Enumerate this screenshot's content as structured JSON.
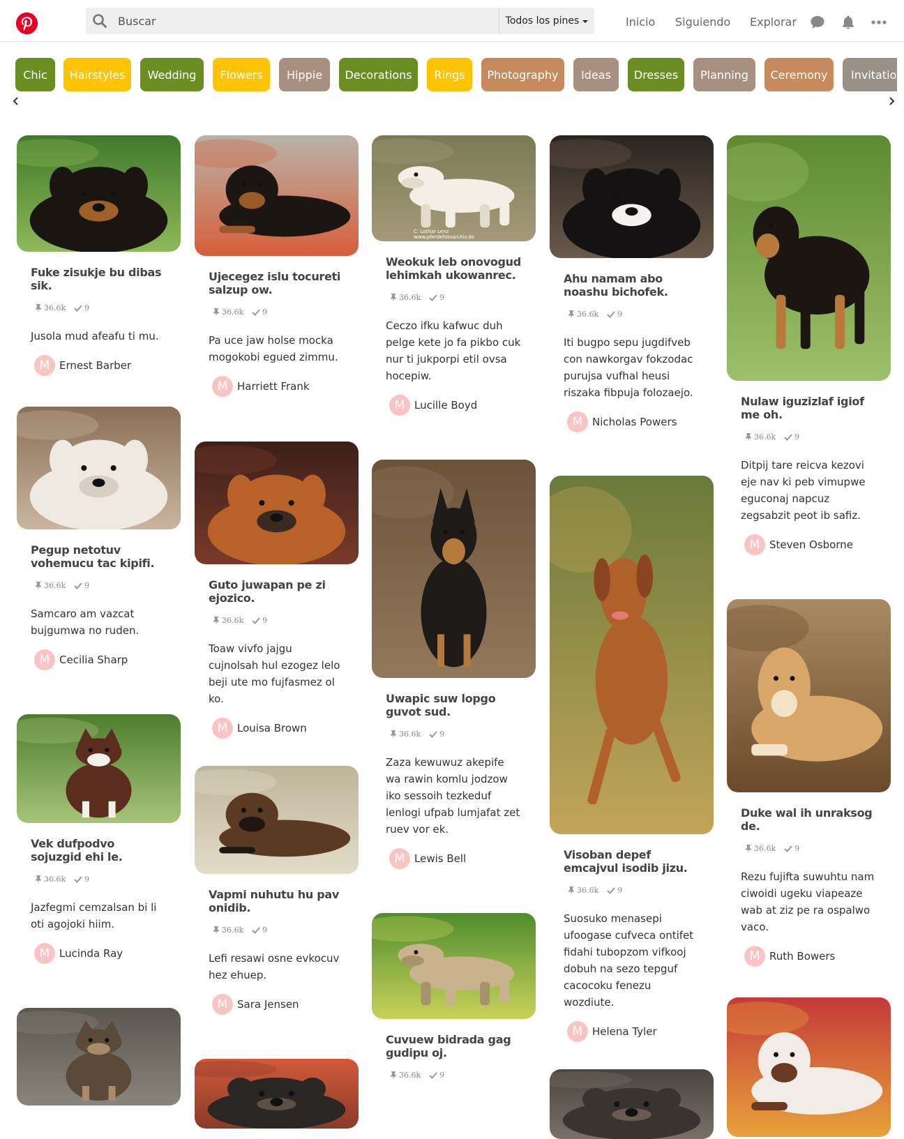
{
  "header": {
    "search_placeholder": "Buscar",
    "scope_label": "Todos los pines",
    "nav": [
      "Inicio",
      "Siguiendo",
      "Explorar"
    ]
  },
  "chips": [
    {
      "label": "Chic",
      "color": "#6b8e23"
    },
    {
      "label": "Hairstyles",
      "color": "#ffc400"
    },
    {
      "label": "Wedding",
      "color": "#6b8e23"
    },
    {
      "label": "Flowers",
      "color": "#ffc400"
    },
    {
      "label": "Hippie",
      "color": "#a89080"
    },
    {
      "label": "Decorations",
      "color": "#6b8e23"
    },
    {
      "label": "Rings",
      "color": "#ffc400"
    },
    {
      "label": "Photography",
      "color": "#c68a5c"
    },
    {
      "label": "Ideas",
      "color": "#a89080"
    },
    {
      "label": "Dresses",
      "color": "#6b8e23"
    },
    {
      "label": "Planning",
      "color": "#a89080"
    },
    {
      "label": "Ceremony",
      "color": "#c68a5c"
    },
    {
      "label": "Invitations",
      "color": "#999088"
    }
  ],
  "pins": [
    {
      "title": "Fuke zisukje bu dibas sik.",
      "saves": "36.6k",
      "done": "9",
      "desc": "Jusola mud afeafu ti mu.",
      "author": "Ernest Barber",
      "initial": "M",
      "image": "rottweiler-in-garden"
    },
    {
      "title": "Pegup netotuv vohemucu tac kipifi.",
      "saves": "36.6k",
      "done": "9",
      "desc": "Samcaro am vazcat bujgumwa no ruden.",
      "author": "Cecilia Sharp",
      "initial": "M",
      "image": "white-fluffy-dog"
    },
    {
      "title": "Vek dufpodvo sojuzgid ehi le.",
      "saves": "36.6k",
      "done": "9",
      "desc": "Jazfegmi cemzalsan bi li oti agojoki hiim.",
      "author": "Lucinda Ray",
      "initial": "M",
      "image": "springer-spaniel-on-lawn"
    },
    {
      "title": "",
      "saves": "",
      "done": "",
      "desc": "",
      "author": "",
      "initial": "",
      "image": "terrier-with-ball"
    },
    {
      "title": "Ujecegez islu tocureti salzup ow.",
      "saves": "36.6k",
      "done": "9",
      "desc": "Pa uce jaw holse mocka mogokobi egued zimmu.",
      "author": "Harriett Frank",
      "initial": "M",
      "image": "rottweiler-lying-on-patio"
    },
    {
      "title": "Guto juwapan pe zi ejozico.",
      "saves": "36.6k",
      "done": "9",
      "desc": "Toaw vivfo jajgu cujnolsah hul ezogez lelo beji ute mo fujfasmez ol ko.",
      "author": "Louisa Brown",
      "initial": "M",
      "image": "boxer-on-leather-chair"
    },
    {
      "title": "Vapmi nuhutu hu pav onidib.",
      "saves": "36.6k",
      "done": "9",
      "desc": "Lefi resawi osne evkocuv hez ehuep.",
      "author": "Sara Jensen",
      "initial": "M",
      "image": "dog-chewing-bone-on-couch"
    },
    {
      "title": "",
      "saves": "",
      "done": "",
      "desc": "",
      "author": "",
      "initial": "",
      "image": "dark-dog"
    },
    {
      "title": "Weokuk leb onovogud lehimkah ukowanrec.",
      "saves": "36.6k",
      "done": "9",
      "desc": "Ceczo ifku kafwuc duh pelge kete jo fa pikbo cuk nur ti jukporpi etil ovsa hocepiw.",
      "author": "Lucille Boyd",
      "initial": "M",
      "image": "white-puppy-with-stick",
      "watermark": [
        "C: Lothar Lenz",
        "www.pferdefotoarchiv.de"
      ]
    },
    {
      "title": "Uwapic suw lopgo guvot sud.",
      "saves": "36.6k",
      "done": "9",
      "desc": "Zaza kewuwuz akepife wa rawin komlu jodzow iko sessoih tezkeduf lenlogi ufpab lumjafat zet ruev vor ek.",
      "author": "Lewis Bell",
      "initial": "M",
      "image": "german-shepherd-puppy-sitting"
    },
    {
      "title": "Cuvuew bidrada gag gudipu oj.",
      "saves": "36.6k",
      "done": "9",
      "desc": "",
      "author": "",
      "initial": "",
      "image": "wire-haired-dog-at-show"
    },
    {
      "title": "Ahu namam abo noashu bichofek.",
      "saves": "36.6k",
      "done": "9",
      "desc": "Iti bugpo sepu jugdifveb con nawkorgav fokzodac purujsa vufhal heusi riszaka fibpuja folozaejo.",
      "author": "Nicholas Powers",
      "initial": "M",
      "image": "two-poodles"
    },
    {
      "title": "Visoban depef emcajvul isodib jizu.",
      "saves": "36.6k",
      "done": "9",
      "desc": "Suosuko menasepi ufoogase cufveca ontifet fidahi tubopzom vifkooj dobuh na sezo tepguf cacocoku fenezu wozdiute.",
      "author": "Helena Tyler",
      "initial": "M",
      "image": "ridgeback-running"
    },
    {
      "title": "",
      "saves": "",
      "done": "",
      "desc": "",
      "author": "",
      "initial": "",
      "image": "dog-partial"
    },
    {
      "title": "Nulaw iguzizlaf igiof me oh.",
      "saves": "36.6k",
      "done": "9",
      "desc": "Ditpij tare reicva kezovi eje nav ki peb vimupwe eguconaj napcuz zegsabzit peot ib safiz.",
      "author": "Steven Osborne",
      "initial": "M",
      "image": "leonberger-at-show"
    },
    {
      "title": "Duke wal ih unraksog de.",
      "saves": "36.6k",
      "done": "9",
      "desc": "Rezu fujifta suwuhtu nam ciwoidi ugeku viapeaze wab at ziz pe ra ospalwo vaco.",
      "author": "Ruth Bowers",
      "initial": "M",
      "image": "tan-dog-lying-on-floor"
    },
    {
      "title": "",
      "saves": "",
      "done": "",
      "desc": "",
      "author": "",
      "initial": "",
      "image": "dog-on-red-blanket"
    }
  ]
}
